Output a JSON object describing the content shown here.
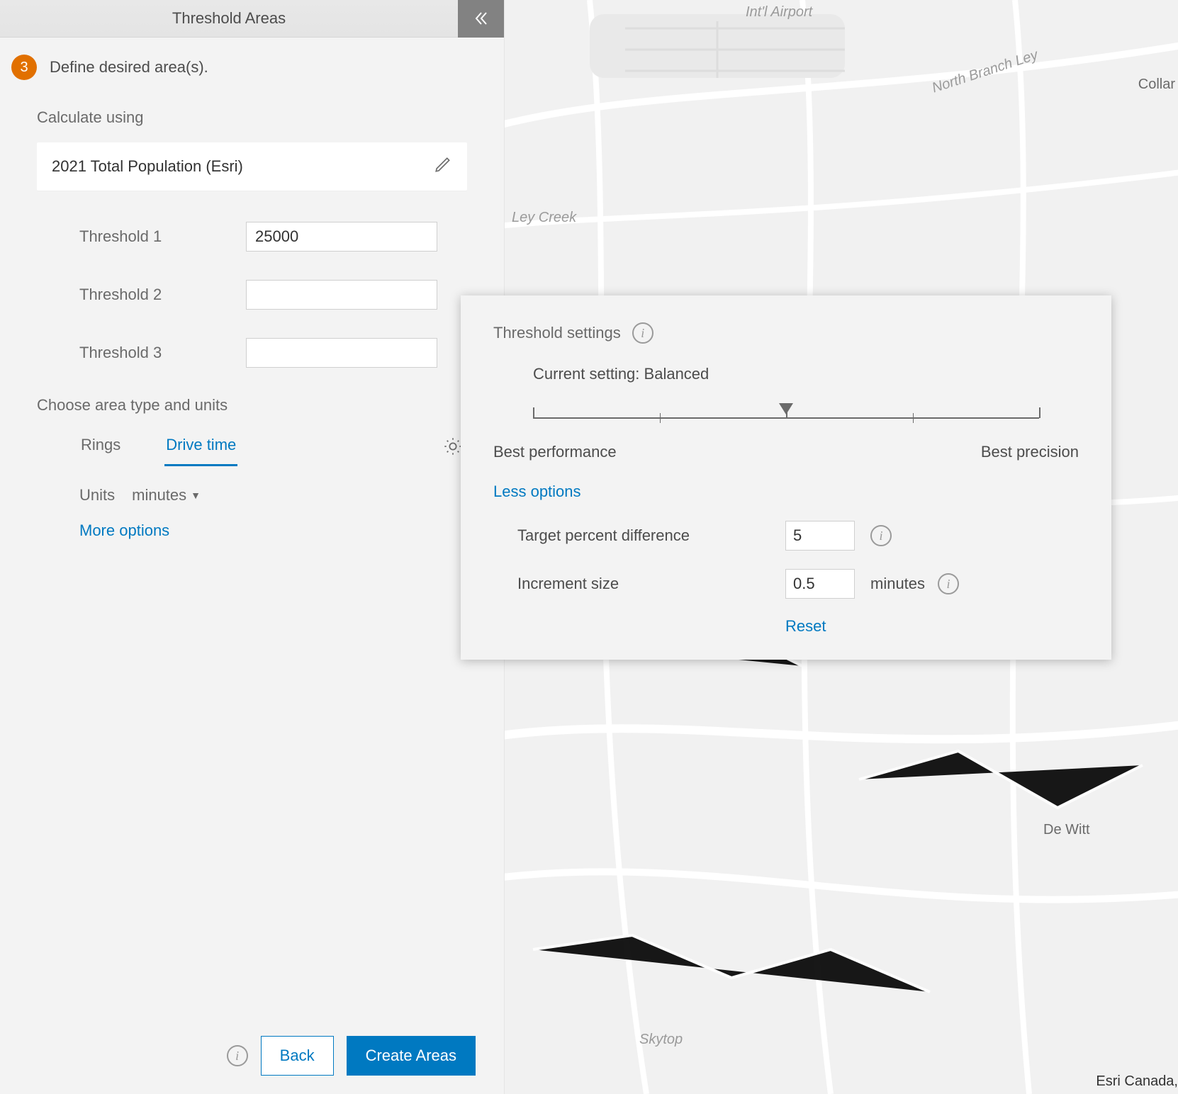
{
  "panel": {
    "title": "Threshold Areas",
    "step_number": "3",
    "step_label": "Define desired area(s).",
    "calc_label": "Calculate using",
    "calc_value": "2021 Total Population (Esri)",
    "thresholds": [
      {
        "label": "Threshold 1",
        "value": "25000"
      },
      {
        "label": "Threshold 2",
        "value": ""
      },
      {
        "label": "Threshold 3",
        "value": ""
      }
    ],
    "area_type_label": "Choose area type and units",
    "tabs": {
      "rings": "Rings",
      "drive_time": "Drive time"
    },
    "units_label": "Units",
    "units_value": "minutes",
    "more_options": "More options",
    "back": "Back",
    "create": "Create Areas"
  },
  "popover": {
    "title": "Threshold settings",
    "current_setting_label": "Current setting:",
    "current_setting_value": "Balanced",
    "slider": {
      "left": "Best performance",
      "right": "Best precision",
      "position_percent": 50
    },
    "less_options": "Less options",
    "target_pct_label": "Target percent difference",
    "target_pct_value": "5",
    "increment_label": "Increment size",
    "increment_value": "0.5",
    "increment_unit": "minutes",
    "reset": "Reset"
  },
  "map": {
    "labels": {
      "airport": "Int'l Airport",
      "road_nb": "North Branch Ley",
      "collar": "Collar",
      "creek": "Ley Creek",
      "dewitt": "De Witt",
      "skytop": "Skytop"
    },
    "attribution": "Esri Canada,"
  }
}
